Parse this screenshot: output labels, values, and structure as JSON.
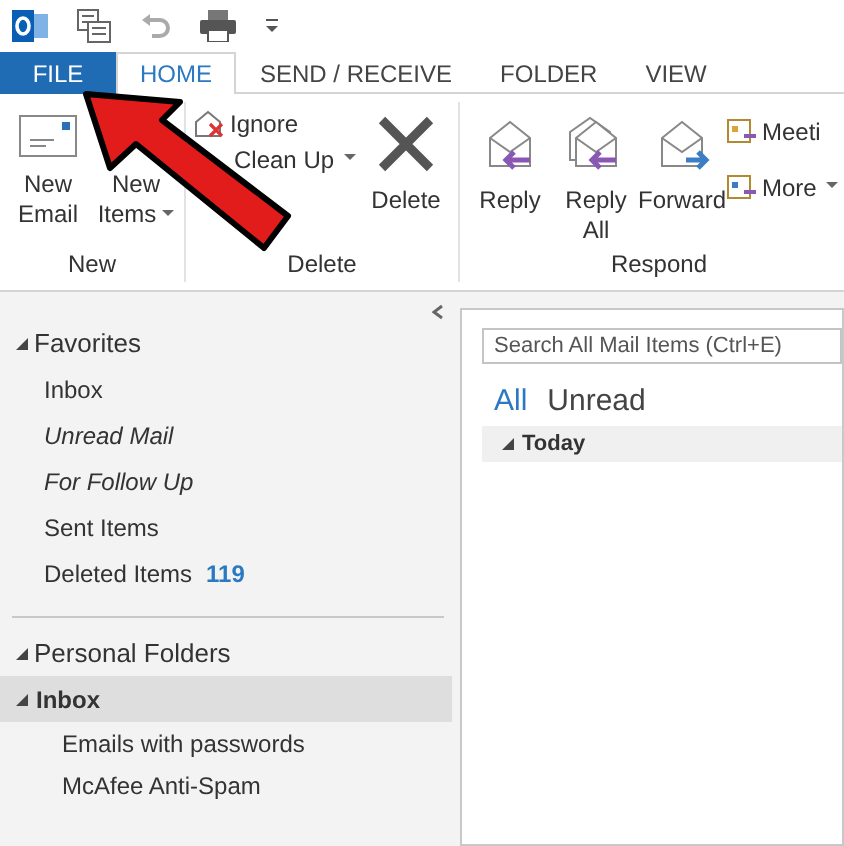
{
  "tabs": [
    {
      "label": "FILE",
      "kind": "file",
      "selected": false
    },
    {
      "label": "HOME",
      "kind": "tab",
      "selected": true
    },
    {
      "label": "SEND / RECEIVE",
      "kind": "tab",
      "selected": false
    },
    {
      "label": "FOLDER",
      "kind": "tab",
      "selected": false
    },
    {
      "label": "VIEW",
      "kind": "tab",
      "selected": false
    }
  ],
  "ribbon": {
    "groups": [
      {
        "label": "New",
        "buttons": [
          {
            "label": "New Email",
            "dropdown": false
          },
          {
            "label": "New Items",
            "dropdown": true
          }
        ]
      },
      {
        "label": "Delete",
        "small_buttons": [
          {
            "label": "Ignore",
            "dropdown": false
          },
          {
            "label": "Clean Up",
            "dropdown": true
          }
        ],
        "buttons": [
          {
            "label": "Delete",
            "dropdown": false
          }
        ]
      },
      {
        "label": "Respond",
        "buttons": [
          {
            "label": "Reply",
            "dropdown": false
          },
          {
            "label": "Reply All",
            "dropdown": false
          },
          {
            "label": "Forward",
            "dropdown": false
          }
        ],
        "small_buttons": [
          {
            "label": "Meeti",
            "dropdown": false
          },
          {
            "label": "More",
            "dropdown": true
          }
        ]
      }
    ]
  },
  "nav": {
    "sections": [
      {
        "label": "Favorites",
        "expanded": true,
        "items": [
          {
            "label": "Inbox",
            "kind": "folder",
            "selected": false
          },
          {
            "label": "Unread Mail",
            "kind": "search_folder",
            "selected": false
          },
          {
            "label": "For Follow Up",
            "kind": "search_folder",
            "selected": false
          },
          {
            "label": "Sent Items",
            "kind": "folder",
            "selected": false
          },
          {
            "label": "Deleted Items",
            "kind": "folder",
            "selected": false,
            "count": "119"
          }
        ]
      },
      {
        "label": "Personal Folders",
        "expanded": true,
        "items": [
          {
            "label": "Inbox",
            "kind": "folder",
            "selected": true,
            "expanded": true,
            "children": [
              {
                "label": "Emails with passwords"
              },
              {
                "label": "McAfee Anti-Spam"
              }
            ]
          }
        ]
      }
    ]
  },
  "mail_list": {
    "search": {
      "placeholder": "Search All Mail Items (Ctrl+E)"
    },
    "filters": [
      {
        "label": "All",
        "selected": true
      },
      {
        "label": "Unread",
        "selected": false
      }
    ],
    "groups": [
      {
        "label": "Today",
        "expanded": true
      }
    ]
  }
}
